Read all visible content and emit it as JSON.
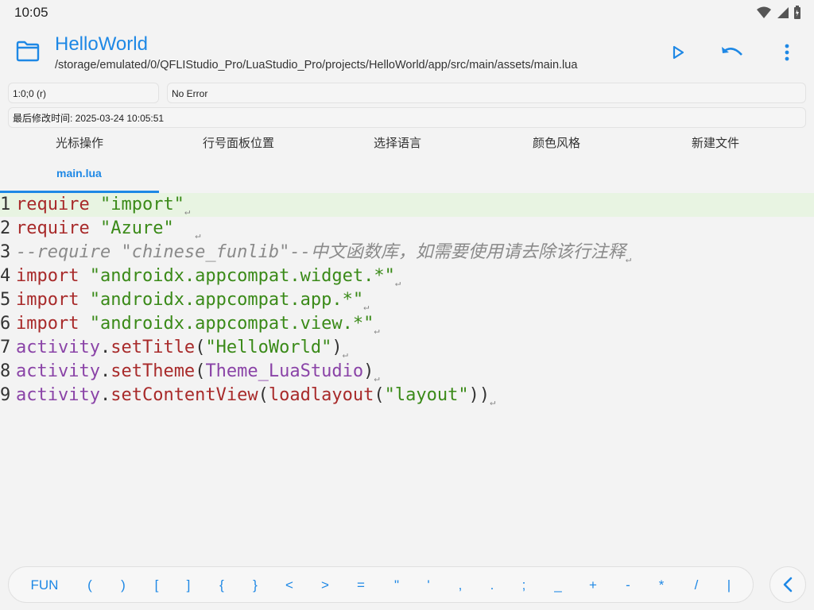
{
  "status": {
    "time": "10:05"
  },
  "header": {
    "title": "HelloWorld",
    "path": "/storage/emulated/0/QFLIStudio_Pro/LuaStudio_Pro/projects/HelloWorld/app/src/main/assets/main.lua"
  },
  "info": {
    "cursor": "1:0;0 (r)",
    "error": "No Error",
    "modified": "最后修改时间: 2025-03-24 10:05:51"
  },
  "toolbar": {
    "items": [
      "光标操作",
      "行号面板位置",
      "选择语言",
      "颜色风格",
      "新建文件"
    ]
  },
  "tabs": [
    {
      "label": "main.lua"
    }
  ],
  "code": {
    "lines": [
      [
        "1",
        "require",
        "\"import\""
      ],
      [
        "2",
        "require",
        "\"Azure\""
      ],
      [
        "3",
        "--require \"chinese_funlib\"--中文函数库，如需要使用请去除该行注释"
      ],
      [
        "4",
        "import",
        "\"androidx.appcompat.widget.*\""
      ],
      [
        "5",
        "import",
        "\"androidx.appcompat.app.*\""
      ],
      [
        "6",
        "import",
        "\"androidx.appcompat.view.*\""
      ],
      [
        "7",
        "activity",
        ".",
        "setTitle",
        "(",
        "\"HelloWorld\"",
        ")"
      ],
      [
        "8",
        "activity",
        ".",
        "setTheme",
        "(",
        "Theme_LuaStudio",
        ")"
      ],
      [
        "9",
        "activity",
        ".",
        "setContentView",
        "(",
        "loadlayout",
        "(",
        "\"layout\"",
        "))"
      ]
    ]
  },
  "keys": [
    "FUN",
    "(",
    ")",
    "[",
    "]",
    "{",
    "}",
    "<",
    ">",
    "=",
    "\"",
    "'",
    ",",
    ".",
    ";",
    "_",
    "+",
    "-",
    "*",
    "/",
    "|"
  ],
  "colors": {
    "accent": "#1e88e5",
    "keyword": "#a82a2a",
    "string": "#3a8a18",
    "comment": "#8a8a8a",
    "variable": "#8a43a7",
    "active_line": "#e8f4e2"
  },
  "icons": {
    "folder": "folder-icon",
    "run": "play-icon",
    "undo": "undo-icon",
    "more": "more-vert-icon",
    "collapse": "chevron-left-icon"
  }
}
